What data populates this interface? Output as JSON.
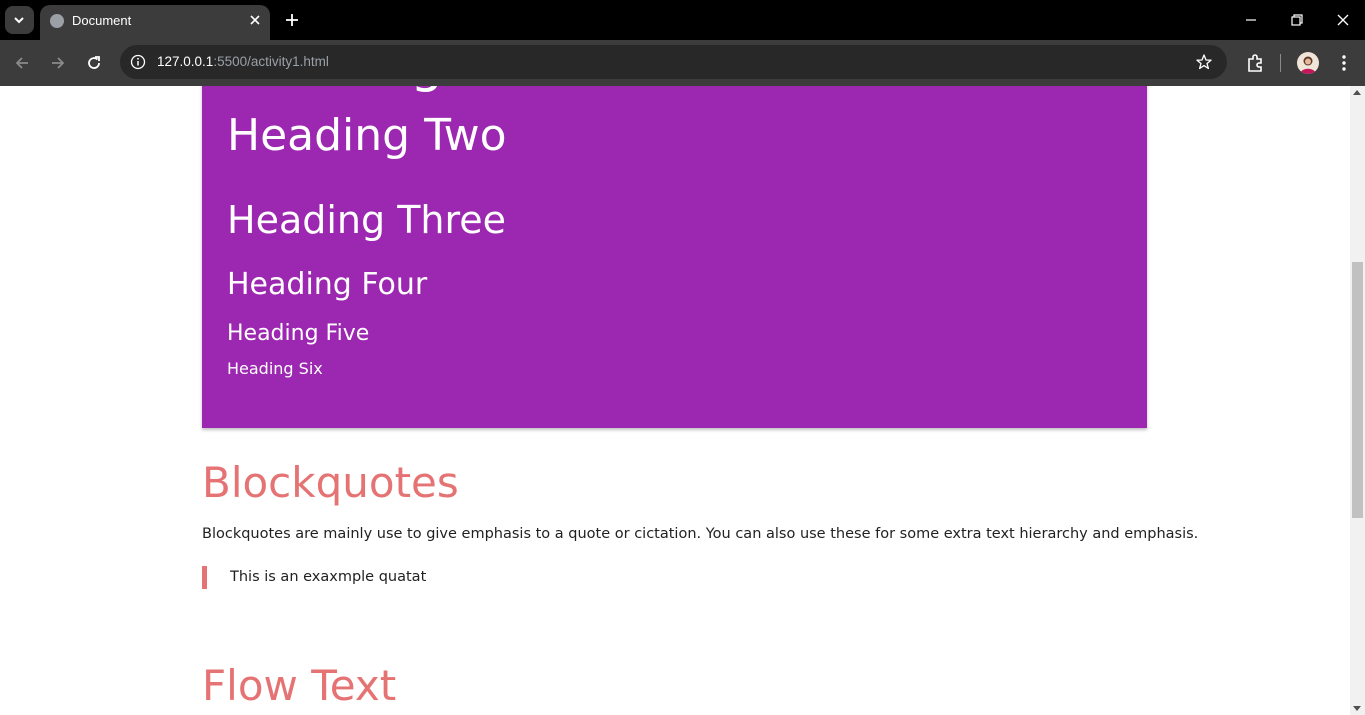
{
  "browser": {
    "tab_title": "Document",
    "url_host": "127.0.0.1",
    "url_path": ":5500/activity1.html"
  },
  "page": {
    "headings": {
      "h1": "Heading One",
      "h2": "Heading Two",
      "h3": "Heading Three",
      "h4": "Heading Four",
      "h5": "Heading Five",
      "h6": "Heading Six"
    },
    "card_color": "#9c27b0",
    "accent_color": "#e57373",
    "blockquotes": {
      "title": "Blockquotes",
      "description": "Blockquotes are mainly use to give emphasis to a quote or cictation. You can also use these for some extra text hierarchy and emphasis.",
      "quote": "This is an exaxmple quatat"
    },
    "flow_text": {
      "title": "Flow Text"
    }
  }
}
